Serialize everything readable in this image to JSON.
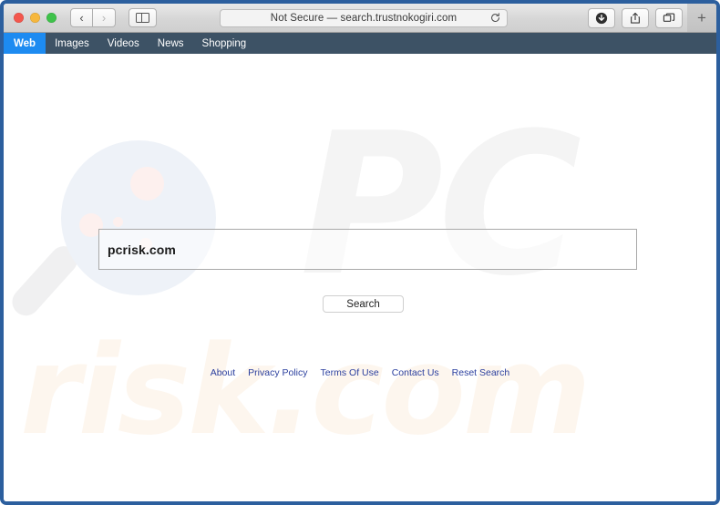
{
  "browser": {
    "url_text": "Not Secure — search.trustnokogiri.com",
    "reload_icon": "reload-icon",
    "back_icon": "‹",
    "forward_icon": "›",
    "plus_label": "+",
    "tools": [
      {
        "name": "downloads-button",
        "icon": "download-icon"
      },
      {
        "name": "share-button",
        "icon": "share-icon"
      },
      {
        "name": "tab-overview-button",
        "icon": "tabs-icon"
      }
    ],
    "traffic_lights": [
      {
        "name": "close-button",
        "color": "#f3564c"
      },
      {
        "name": "minimize-button",
        "color": "#f6b73d"
      },
      {
        "name": "maximize-button",
        "color": "#3ec24a"
      }
    ]
  },
  "sitenav": {
    "items": [
      {
        "label": "Web",
        "active": true
      },
      {
        "label": "Images",
        "active": false
      },
      {
        "label": "Videos",
        "active": false
      },
      {
        "label": "News",
        "active": false
      },
      {
        "label": "Shopping",
        "active": false
      }
    ]
  },
  "search": {
    "query_value": "pcrisk.com",
    "placeholder": "",
    "button_label": "Search"
  },
  "watermark": {
    "top_text": "PC",
    "bottom_text": "risk.com",
    "magnifier_icon": "magnifier-icon"
  },
  "footer": {
    "links": [
      "About",
      "Privacy Policy",
      "Terms Of Use",
      "Contact Us",
      "Reset Search"
    ]
  },
  "colors": {
    "nav_bg": "#3d5265",
    "nav_active": "#1d8bf1",
    "window_border": "#2c5f9e",
    "link": "#2b3f9e",
    "watermark_pc": "#f4f4f4",
    "watermark_risk": "#fdf6ee"
  }
}
